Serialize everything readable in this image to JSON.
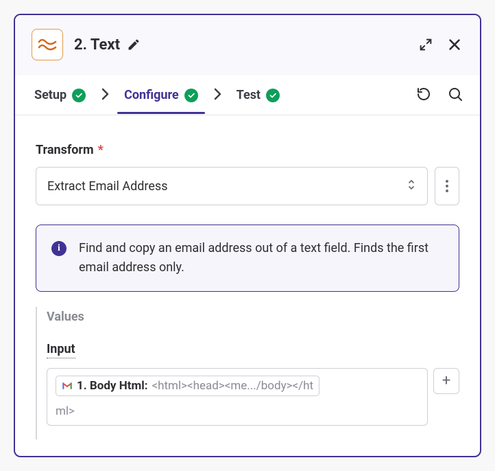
{
  "header": {
    "title": "2.  Text"
  },
  "tabs": {
    "setup": "Setup",
    "configure": "Configure",
    "test": "Test"
  },
  "transform": {
    "label": "Transform",
    "value": "Extract Email Address"
  },
  "info": {
    "text": "Find and copy an email address out of a text field. Finds the first email address only."
  },
  "values": {
    "section_title": "Values",
    "input_label": "Input",
    "pill_label": "1. Body Html:",
    "pill_value": "<html><head><me.../body></ht",
    "overflow": "ml>"
  }
}
